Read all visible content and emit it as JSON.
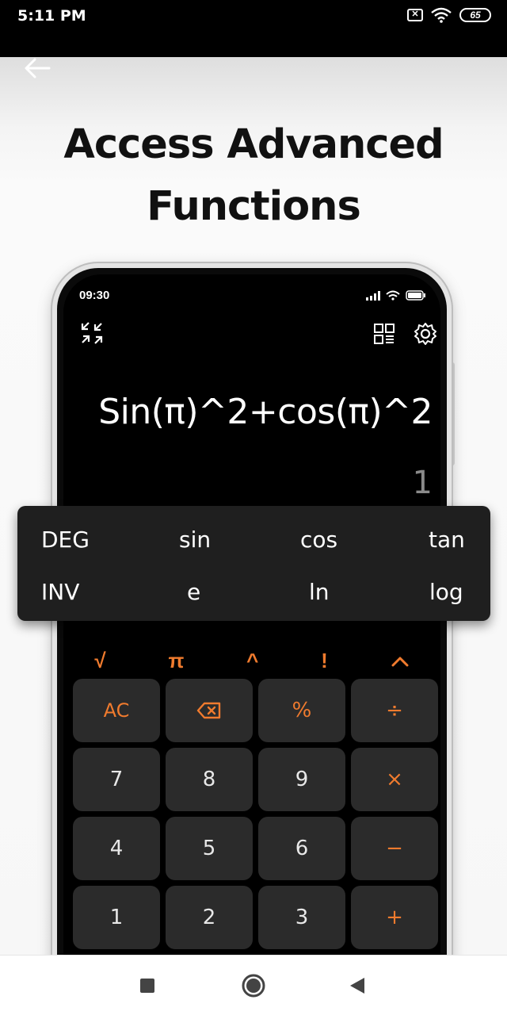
{
  "status_bar": {
    "time": "5:11 PM",
    "battery": "65"
  },
  "promo": {
    "headline_line1": "Access Advanced",
    "headline_line2": "Functions"
  },
  "calculator": {
    "time": "09:30",
    "expression": "Sin(π)^2+cos(π)^2",
    "result": "1",
    "scientific_row": [
      "√",
      "π",
      "^",
      "!",
      "^"
    ],
    "keys": [
      {
        "label": "AC",
        "kind": "fn"
      },
      {
        "label": "backspace",
        "kind": "fn"
      },
      {
        "label": "%",
        "kind": "op"
      },
      {
        "label": "÷",
        "kind": "op"
      },
      {
        "label": "7",
        "kind": "num"
      },
      {
        "label": "8",
        "kind": "num"
      },
      {
        "label": "9",
        "kind": "num"
      },
      {
        "label": "×",
        "kind": "op"
      },
      {
        "label": "4",
        "kind": "num"
      },
      {
        "label": "5",
        "kind": "num"
      },
      {
        "label": "6",
        "kind": "num"
      },
      {
        "label": "−",
        "kind": "op"
      },
      {
        "label": "1",
        "kind": "num"
      },
      {
        "label": "2",
        "kind": "num"
      },
      {
        "label": "3",
        "kind": "num"
      },
      {
        "label": "+",
        "kind": "op"
      }
    ]
  },
  "popup": {
    "row1": [
      "DEG",
      "sin",
      "cos",
      "tan"
    ],
    "row2": [
      "INV",
      "e",
      "ln",
      "log"
    ]
  },
  "colors": {
    "accent": "#f07b2e",
    "key_bg": "#2b2b2b",
    "screen_bg": "#000000"
  }
}
